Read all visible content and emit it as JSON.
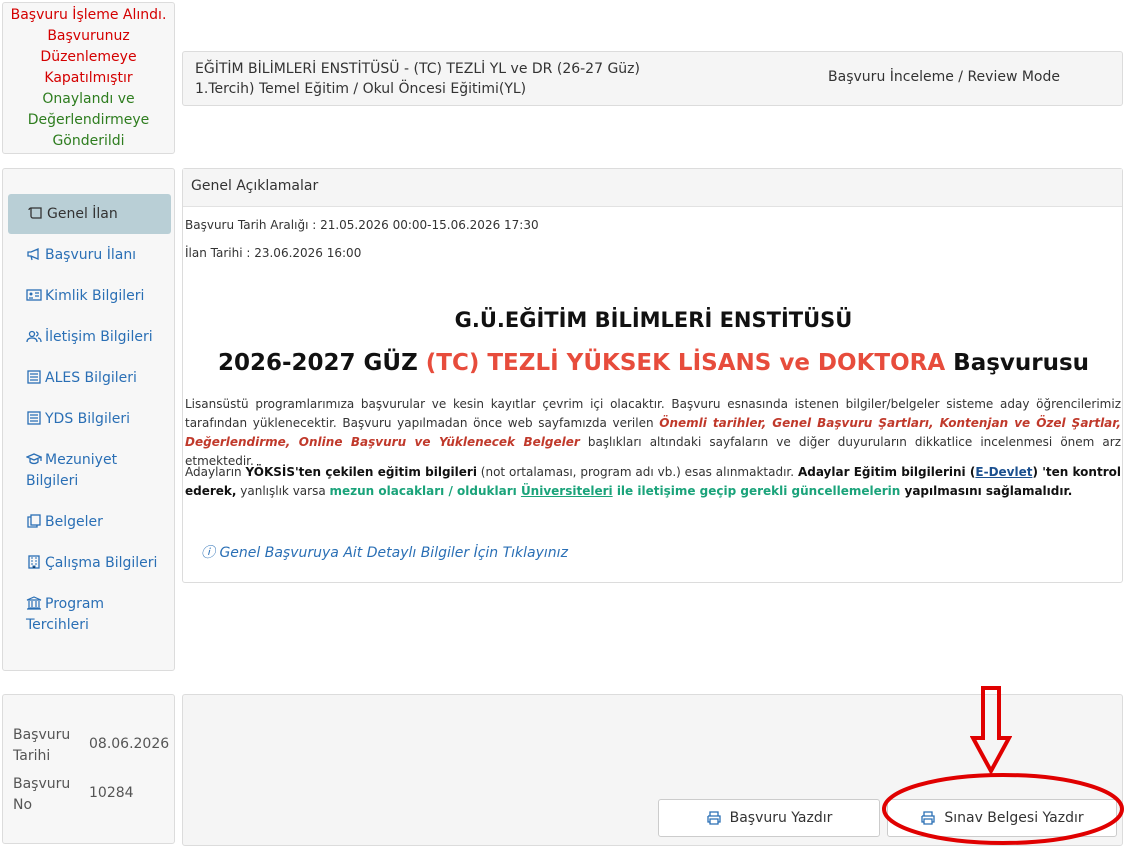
{
  "status": {
    "red_lines": [
      "Başvuru İşleme Alındı.",
      "Başvurunuz",
      "Düzenlemeye",
      "Kapatılmıştır"
    ],
    "green_lines": [
      "Onaylandı ve",
      "Değerlendirmeye",
      "Gönderildi"
    ]
  },
  "program": {
    "line1": "EĞİTİM BİLİMLERİ ENSTİTÜSÜ - (TC) TEZLİ YL ve DR (26-27 Güz)",
    "line2": "1.Tercih) Temel Eğitim / Okul Öncesi Eğitimi(YL)",
    "mode": "Başvuru İnceleme / Review Mode"
  },
  "sidebar": {
    "items": [
      {
        "label": "Genel İlan",
        "icon": "scroll-icon",
        "active": true
      },
      {
        "label": "Başvuru İlanı",
        "icon": "megaphone-icon"
      },
      {
        "label": "Kimlik Bilgileri",
        "icon": "id-card-icon"
      },
      {
        "label": "İletişim Bilgileri",
        "icon": "contacts-icon"
      },
      {
        "label": "ALES Bilgileri",
        "icon": "document-list-icon"
      },
      {
        "label": "YDS Bilgileri",
        "icon": "document-list-icon"
      },
      {
        "label": "Mezuniyet",
        "label2": "Bilgileri",
        "icon": "graduation-cap-icon"
      },
      {
        "label": "Belgeler",
        "icon": "copy-icon"
      },
      {
        "label": "Çalışma Bilgileri",
        "icon": "building-icon"
      },
      {
        "label": "Program",
        "label2": "Tercihleri",
        "icon": "institution-icon"
      }
    ]
  },
  "content": {
    "header": "Genel Açıklamalar",
    "date_range": "Başvuru Tarih Aralığı : 21.05.2026 00:00-15.06.2026 17:30",
    "announce_date": "İlan Tarihi : 23.06.2026 16:00",
    "title1": "G.Ü.EĞİTİM BİLİMLERİ ENSTİTÜSÜ",
    "title2_a": "2026-2027 GÜZ ",
    "title2_b": "(TC) TEZLİ YÜKSEK LİSANS ve DOKTORA",
    "title2_c": " Başvurusu",
    "p1_a": "Lisansüstü programlarımıza başvurular ve kesin kayıtlar çevrim içi olacaktır. Başvuru esnasında istenen bilgiler/belgeler sisteme aday öğrencilerimiz tarafından yüklenecektir. Başvuru yapılmadan önce web sayfamızda verilen ",
    "p1_b": "Önemli tarihler, Genel Başvuru Şartları, Kontenjan ve Özel Şartlar, Değerlendirme, Online Başvuru ve Yüklenecek Belgeler",
    "p1_c": " başlıkları altındaki sayfaların ve diğer duyuruların dikkatlice incelenmesi önem arz etmektedir.",
    "p2_a": "Adayların ",
    "p2_b": "YÖKSİS'ten çekilen eğitim bilgileri",
    "p2_c": " (not ortalaması, program adı vb.) esas alınmaktadır. ",
    "p2_d": "Adaylar Eğitim bilgilerini  (",
    "p2_e": "E-Devlet",
    "p2_f": ") 'ten kontrol ederek,",
    "p2_g": " yanlışlık varsa ",
    "p2_h": "mezun olacakları / oldukları ",
    "p2_i": "Üniversiteleri",
    "p2_j": " ile iletişime geçip gerekli güncellemelerin",
    "p2_k": " yapılmasını sağlamalıdır.",
    "detail_link": "Genel Başvuruya Ait Detaylı Bilgiler İçin Tıklayınız"
  },
  "app_info": {
    "date_label": "Başvuru Tarihi",
    "date_value": "08.06.2026",
    "no_label": "Başvuru No",
    "no_value": "10284"
  },
  "actions": {
    "print_application": "Başvuru Yazdır",
    "print_exam_doc": "Sınav Belgesi Yazdır"
  },
  "colors": {
    "status_red": "#d40000",
    "status_green": "#2e7d1f",
    "link_blue": "#2a6fb5",
    "title_red": "#e74c3c",
    "teal": "#1aa37a",
    "annotation_red": "#e00000"
  }
}
